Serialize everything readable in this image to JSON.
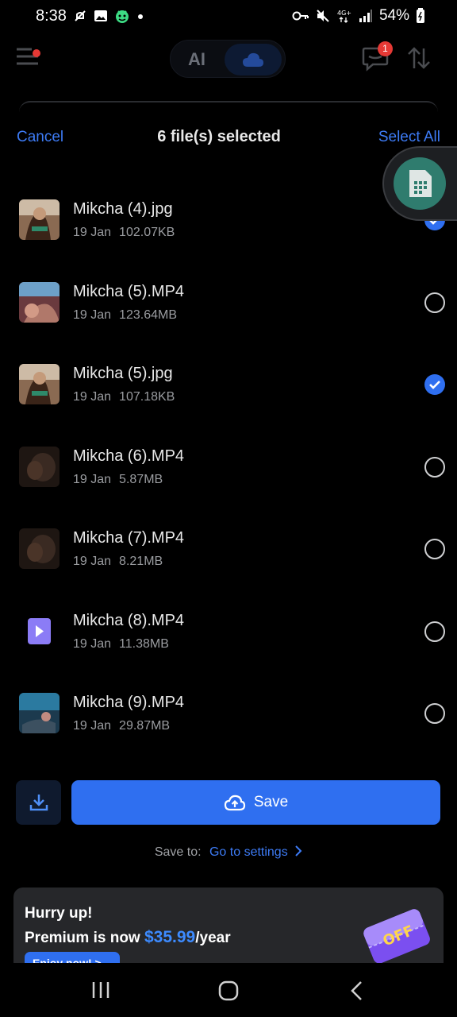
{
  "status": {
    "time": "8:38",
    "battery": "54%",
    "left_icons": [
      "mute-notification-icon",
      "gallery-icon",
      "android-icon",
      "dot-icon"
    ],
    "right_icons": [
      "key-icon",
      "mute-icon",
      "4g-icon",
      "signal-icon",
      "battery-icon"
    ]
  },
  "app_bar": {
    "ai_label": "AI",
    "chat_badge": "1"
  },
  "sheet": {
    "cancel": "Cancel",
    "title": "6 file(s) selected",
    "select_all": "Select All"
  },
  "files": [
    {
      "name": "Mikcha (4).jpg",
      "date": "19 Jan",
      "size": "102.07KB",
      "checked": true,
      "thumb": "photo"
    },
    {
      "name": "Mikcha (5).MP4",
      "date": "19 Jan",
      "size": "123.64MB",
      "checked": false,
      "thumb": "video"
    },
    {
      "name": "Mikcha (5).jpg",
      "date": "19 Jan",
      "size": "107.18KB",
      "checked": true,
      "thumb": "photo"
    },
    {
      "name": "Mikcha (6).MP4",
      "date": "19 Jan",
      "size": "5.87MB",
      "checked": false,
      "thumb": "dark"
    },
    {
      "name": "Mikcha (7).MP4",
      "date": "19 Jan",
      "size": "8.21MB",
      "checked": false,
      "thumb": "dark"
    },
    {
      "name": "Mikcha (8).MP4",
      "date": "19 Jan",
      "size": "11.38MB",
      "checked": false,
      "thumb": "video-icon"
    },
    {
      "name": "Mikcha (9).MP4",
      "date": "19 Jan",
      "size": "29.87MB",
      "checked": false,
      "thumb": "blue"
    }
  ],
  "actions": {
    "save": "Save",
    "save_to_label": "Save to:",
    "go_to_settings": "Go to settings"
  },
  "promo": {
    "hurry": "Hurry up!",
    "line_prefix": "Premium is now ",
    "price": "$35.99",
    "line_suffix": "/year",
    "enjoy": "Enjoy now! >",
    "badge": "OFF"
  },
  "colors": {
    "accent": "#2f6ff0",
    "link": "#3d7bf5",
    "background": "#000000"
  }
}
